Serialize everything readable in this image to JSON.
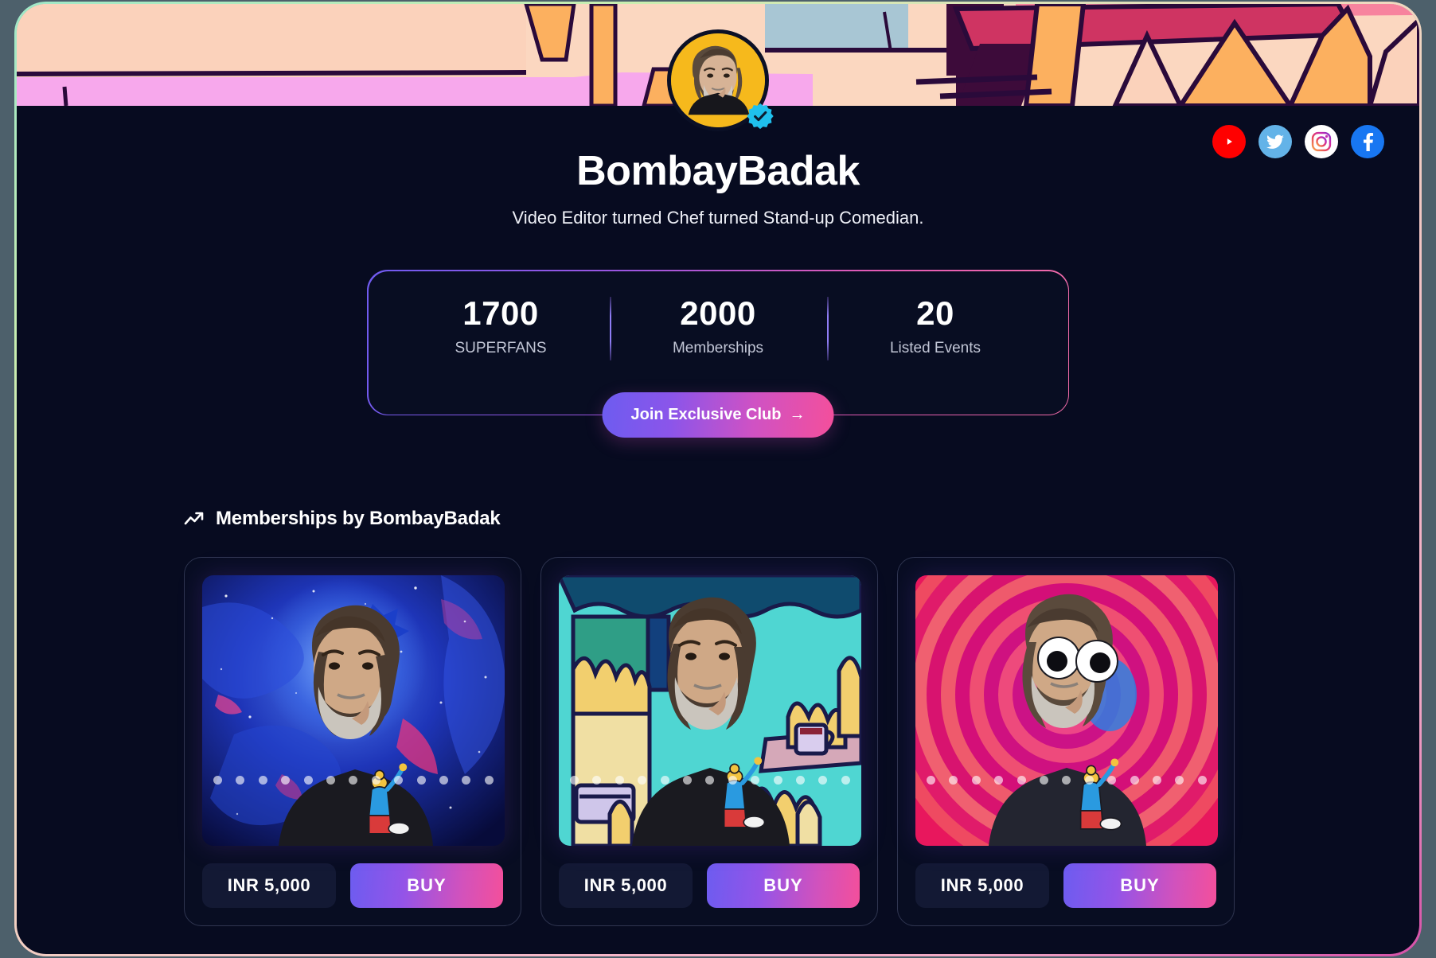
{
  "profile": {
    "name": "BombayBadak",
    "tagline": "Video Editor turned Chef turned Stand-up Comedian.",
    "verified": true,
    "avatar_bg": "#f6b91c",
    "badge_color": "#1fc0ed"
  },
  "socials": [
    {
      "name": "youtube",
      "label": "YouTube",
      "color": "#ff0000"
    },
    {
      "name": "twitter",
      "label": "Twitter",
      "color": "#63b3e8"
    },
    {
      "name": "instagram",
      "label": "Instagram",
      "color": "#ffffff"
    },
    {
      "name": "facebook",
      "label": "Facebook",
      "color": "#1877f2"
    }
  ],
  "stats": [
    {
      "value": "1700",
      "label": "SUPERFANS"
    },
    {
      "value": "2000",
      "label": "Memberships"
    },
    {
      "value": "20",
      "label": "Listed Events"
    }
  ],
  "cta": {
    "join_label": "Join Exclusive Club",
    "arrow": "→"
  },
  "section": {
    "icon": "trending-up-icon",
    "title": "Memberships by BombayBadak"
  },
  "memberships": [
    {
      "price": "INR 5,000",
      "buy_label": "BUY",
      "theme": "cosmic-blue",
      "dots": 13
    },
    {
      "price": "INR 5,000",
      "buy_label": "BUY",
      "theme": "teal-cartoon",
      "dots": 13
    },
    {
      "price": "INR 5,000",
      "buy_label": "BUY",
      "theme": "pink-rings",
      "dots": 13
    }
  ],
  "theme": {
    "page_bg": "#070b20",
    "card_bg": "#080d22",
    "card_border": "#2f3550",
    "accent_start": "#6d5cf0",
    "accent_end": "#f44f9b",
    "text_primary": "#ffffff",
    "text_muted": "#c2c6d6",
    "outer_bg": "#4d606b"
  }
}
